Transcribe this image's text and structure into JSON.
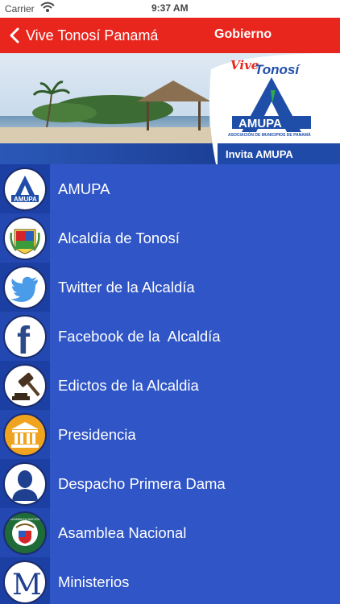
{
  "status_bar": {
    "carrier": "Carrier",
    "time": "9:37 AM"
  },
  "nav": {
    "back_label": "Vive Tonosí Panamá",
    "title": "Gobierno"
  },
  "banner": {
    "brand_script": "Vive",
    "brand_name": "Tonosí",
    "logo_letters": "AMUPA",
    "logo_caption": "ASOCIACIÓN DE MUNICIPIOS DE PANAMÁ",
    "tagline": "Invita  AMUPA"
  },
  "items": [
    {
      "label": "AMUPA",
      "icon": "amupa-logo-icon",
      "icon_text": "AMUPA"
    },
    {
      "label": "Alcaldía de Tonosí",
      "icon": "coat-of-arms-icon"
    },
    {
      "label": "Twitter de la Alcaldía",
      "icon": "twitter-bird-icon"
    },
    {
      "label": "Facebook de la  Alcaldía",
      "icon": "facebook-icon",
      "icon_text": "f"
    },
    {
      "label": "Edictos de la Alcaldia",
      "icon": "gavel-icon"
    },
    {
      "label": "Presidencia",
      "icon": "building-columns-icon"
    },
    {
      "label": "Despacho Primera Dama",
      "icon": "person-silhouette-icon"
    },
    {
      "label": "Asamblea Nacional",
      "icon": "national-assembly-seal-icon",
      "icon_text": "ASAMBLEA NACIONAL"
    },
    {
      "label": "Ministerios",
      "icon": "ministerios-m-icon",
      "icon_text": "M"
    }
  ],
  "colors": {
    "navbar": "#e8261e",
    "list_background": "#2f55c6",
    "icon_column_even": "#1b3fa3",
    "icon_column_odd": "#2448b2",
    "logo_blue": "#1e4ea8",
    "logo_green": "#2fa84f"
  }
}
